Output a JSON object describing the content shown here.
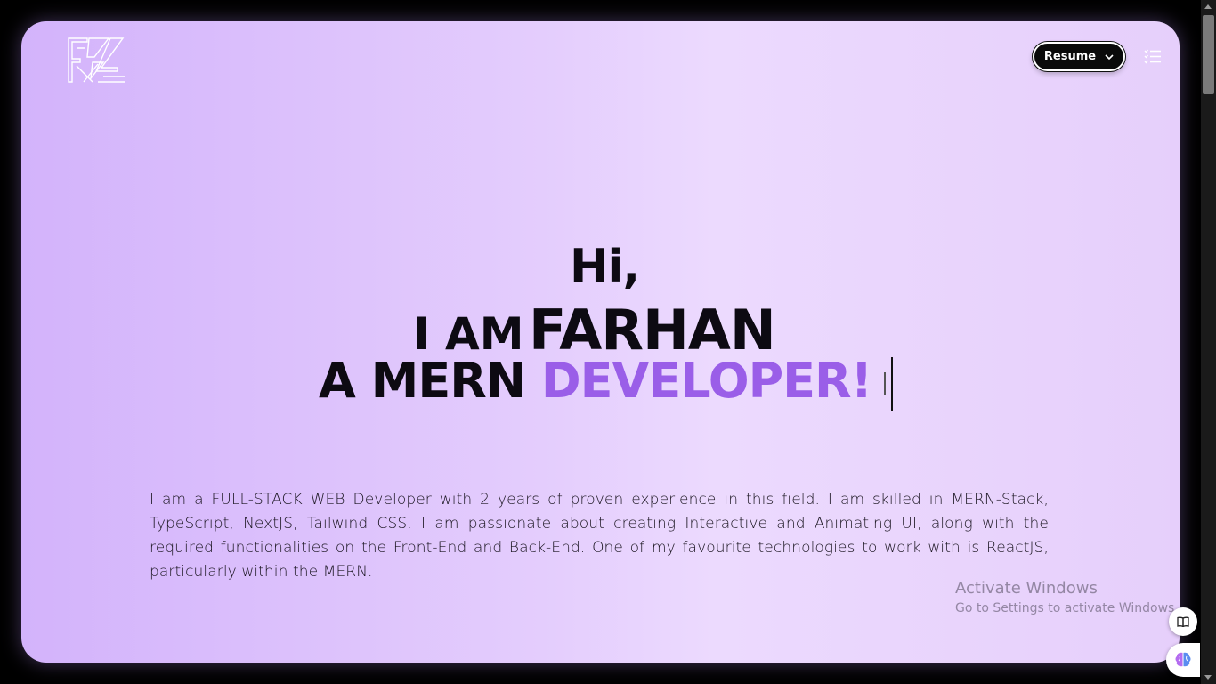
{
  "logo": {
    "icon": "fz-monogram-logo"
  },
  "header": {
    "resume_label": "Resume",
    "menu_icon": "list-menu-icon"
  },
  "hero": {
    "greeting": "Hi,",
    "line2_prefix": "I AM",
    "line2_name": "FARHAN",
    "line3_prefix": "A MERN",
    "line3_accent": "DEVELOPER!",
    "accent_color": "#9a5ee8"
  },
  "intro": {
    "text": "I am a FULL-STACK WEB Developer with 2 years of proven experience in this field. I am skilled in MERN-Stack, TypeScript, NextJS, Tailwind CSS. I am passionate about creating Interactive and Animating UI, along with the required functionalities on the Front-End and Back-End. One of my favourite technologies to work with is ReactJS, particularly within the MERN."
  },
  "watermark": {
    "title": "Activate Windows",
    "subtitle": "Go to Settings to activate Windows."
  },
  "floating": {
    "book_icon": "book-icon",
    "brain_icon": "brain-icon"
  }
}
